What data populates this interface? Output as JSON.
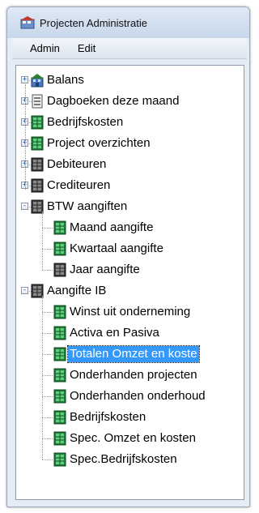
{
  "window": {
    "title": "Projecten Administratie"
  },
  "menu": {
    "items": [
      "Admin",
      "Edit"
    ]
  },
  "tree": {
    "nodes": [
      {
        "label": "Balans",
        "icon": "building-icon",
        "expander": "+"
      },
      {
        "label": "Dagboeken deze maand",
        "icon": "journal-icon",
        "expander": "+"
      },
      {
        "label": "Bedrijfskosten",
        "icon": "green-ledger-icon",
        "expander": "+"
      },
      {
        "label": "Project overzichten",
        "icon": "green-ledger-icon",
        "expander": "+"
      },
      {
        "label": "Debiteuren",
        "icon": "dark-ledger-icon",
        "expander": "+"
      },
      {
        "label": "Crediteuren",
        "icon": "dark-ledger-icon",
        "expander": "+"
      },
      {
        "label": "BTW aangiften",
        "icon": "dark-ledger-icon",
        "expander": "-",
        "children": [
          {
            "label": "Maand aangifte",
            "icon": "green-ledger-icon"
          },
          {
            "label": "Kwartaal aangifte",
            "icon": "green-ledger-icon"
          },
          {
            "label": "Jaar aangifte",
            "icon": "dark-ledger-icon"
          }
        ]
      },
      {
        "label": "Aangifte IB",
        "icon": "dark-ledger-icon",
        "expander": "-",
        "children": [
          {
            "label": "Winst uit onderneming",
            "icon": "green-ledger-icon"
          },
          {
            "label": "Activa en Pasiva",
            "icon": "green-ledger-icon"
          },
          {
            "label": "Totalen Omzet en koste",
            "icon": "green-ledger-icon",
            "selected": true
          },
          {
            "label": "Onderhanden projecten",
            "icon": "green-ledger-icon"
          },
          {
            "label": "Onderhanden onderhoud",
            "icon": "green-ledger-icon"
          },
          {
            "label": "Bedrijfskosten",
            "icon": "green-ledger-icon"
          },
          {
            "label": "Spec. Omzet en kosten",
            "icon": "green-ledger-icon"
          },
          {
            "label": "Spec.Bedrijfskosten",
            "icon": "green-ledger-icon"
          }
        ]
      }
    ]
  }
}
